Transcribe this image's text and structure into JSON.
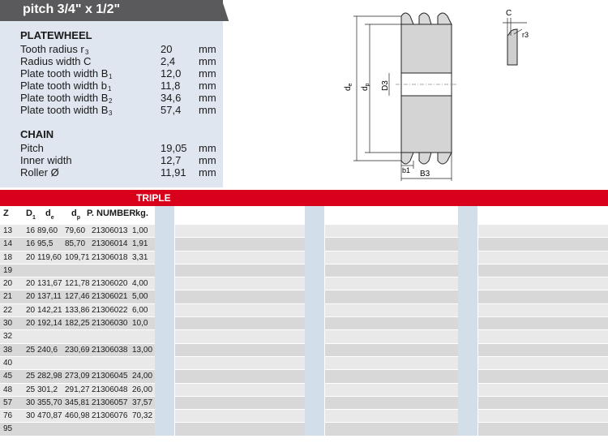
{
  "title": "pitch 3/4\" x 1/2\"",
  "platewheel": {
    "heading": "PLATEWHEEL",
    "rows": [
      {
        "label": "Tooth radius r",
        "sub": "3",
        "value": "20",
        "unit": "mm"
      },
      {
        "label": "Radius width C",
        "sub": "",
        "value": "2,4",
        "unit": "mm"
      },
      {
        "label": "Plate tooth width B",
        "sub": "1",
        "value": "12,0",
        "unit": "mm"
      },
      {
        "label": "Plate tooth width b",
        "sub": "1",
        "value": "11,8",
        "unit": "mm"
      },
      {
        "label": "Plate tooth width B",
        "sub": "2",
        "value": "34,6",
        "unit": "mm"
      },
      {
        "label": "Plate tooth width B",
        "sub": "3",
        "value": "57,4",
        "unit": "mm"
      }
    ]
  },
  "chain": {
    "heading": "CHAIN",
    "rows": [
      {
        "label": "Pitch",
        "value": "19,05",
        "unit": "mm"
      },
      {
        "label": "Inner width",
        "value": "12,7",
        "unit": "mm"
      },
      {
        "label": "Roller Ø",
        "value": "11,91",
        "unit": "mm"
      }
    ]
  },
  "drawing": {
    "labels": {
      "de": "d",
      "de_sub": "e",
      "dp": "d",
      "dp_sub": "p",
      "d3": "D3",
      "b1": "b1",
      "b3": "B3",
      "c": "C",
      "r3": "r3"
    }
  },
  "section": {
    "title": "TRIPLE"
  },
  "table": {
    "headers": {
      "z": "Z",
      "d1": "D",
      "d1_sub": "1",
      "de": "d",
      "de_sub": "e",
      "dp": "d",
      "dp_sub": "p",
      "pn": "P. NUMBER",
      "kg": "kg."
    },
    "rows": [
      {
        "z": "13",
        "d1": "16",
        "de": "89,60",
        "dp": "79,60",
        "pn": "21306013",
        "kg": "1,00"
      },
      {
        "z": "14",
        "d1": "16",
        "de": "95,5",
        "dp": "85,70",
        "pn": "21306014",
        "kg": "1,91"
      },
      {
        "z": "18",
        "d1": "20",
        "de": "119,60",
        "dp": "109,71",
        "pn": "21306018",
        "kg": "3,31"
      },
      {
        "z": "19",
        "d1": "",
        "de": "",
        "dp": "",
        "pn": "",
        "kg": ""
      },
      {
        "z": "20",
        "d1": "20",
        "de": "131,67",
        "dp": "121,78",
        "pn": "21306020",
        "kg": "4,00"
      },
      {
        "z": "21",
        "d1": "20",
        "de": "137,11",
        "dp": "127,46",
        "pn": "21306021",
        "kg": "5,00"
      },
      {
        "z": "22",
        "d1": "20",
        "de": "142,21",
        "dp": "133,86",
        "pn": "21306022",
        "kg": "6,00"
      },
      {
        "z": "30",
        "d1": "20",
        "de": "192,14",
        "dp": "182,25",
        "pn": "21306030",
        "kg": "10,0"
      },
      {
        "z": "32",
        "d1": "",
        "de": "",
        "dp": "",
        "pn": "",
        "kg": ""
      },
      {
        "z": "38",
        "d1": "25",
        "de": "240,6",
        "dp": "230,69",
        "pn": "21306038",
        "kg": "13,00"
      },
      {
        "z": "40",
        "d1": "",
        "de": "",
        "dp": "",
        "pn": "",
        "kg": ""
      },
      {
        "z": "45",
        "d1": "25",
        "de": "282,98",
        "dp": "273,09",
        "pn": "21306045",
        "kg": "24,00"
      },
      {
        "z": "48",
        "d1": "25",
        "de": "301,2",
        "dp": "291,27",
        "pn": "21306048",
        "kg": "26,00"
      },
      {
        "z": "57",
        "d1": "30",
        "de": "355,70",
        "dp": "345,81",
        "pn": "21306057",
        "kg": "37,57"
      },
      {
        "z": "76",
        "d1": "30",
        "de": "470,87",
        "dp": "460,98",
        "pn": "21306076",
        "kg": "70,32"
      },
      {
        "z": "95",
        "d1": "",
        "de": "",
        "dp": "",
        "pn": "",
        "kg": ""
      }
    ]
  },
  "colors": {
    "accent_red": "#d9001b",
    "title_gray": "#5a5a5c",
    "spec_bg": "#dfe6ef",
    "stripe_blue": "#d3deeb"
  }
}
